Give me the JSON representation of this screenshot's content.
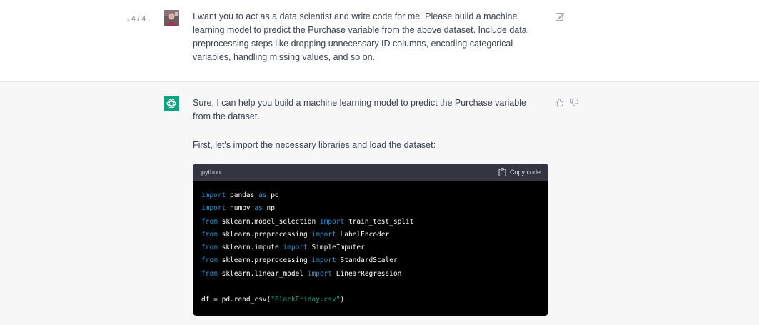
{
  "user_message": {
    "pager": {
      "current": "4",
      "separator": "/",
      "total": "4"
    },
    "text": "I want you to act as a data scientist and write code for me. Please build a machine learning model to predict the Purchase variable from the above dataset. Include data preprocessing steps like dropping unnecessary ID columns, encoding categorical variables, handling missing values, and so on."
  },
  "assistant_message": {
    "paragraphs": [
      "Sure, I can help you build a machine learning model to predict the Purchase variable from the dataset.",
      "First, let's import the necessary libraries and load the dataset:"
    ],
    "code_block": {
      "language": "python",
      "copy_label": "Copy code",
      "lines": [
        [
          {
            "t": "import",
            "c": "kw"
          },
          {
            "t": " pandas "
          },
          {
            "t": "as",
            "c": "kw"
          },
          {
            "t": " pd"
          }
        ],
        [
          {
            "t": "import",
            "c": "kw"
          },
          {
            "t": " numpy "
          },
          {
            "t": "as",
            "c": "kw"
          },
          {
            "t": " np"
          }
        ],
        [
          {
            "t": "from",
            "c": "kw"
          },
          {
            "t": " sklearn.model_selection "
          },
          {
            "t": "import",
            "c": "kw"
          },
          {
            "t": " train_test_split"
          }
        ],
        [
          {
            "t": "from",
            "c": "kw"
          },
          {
            "t": " sklearn.preprocessing "
          },
          {
            "t": "import",
            "c": "kw"
          },
          {
            "t": " LabelEncoder"
          }
        ],
        [
          {
            "t": "from",
            "c": "kw"
          },
          {
            "t": " sklearn.impute "
          },
          {
            "t": "import",
            "c": "kw"
          },
          {
            "t": " SimpleImputer"
          }
        ],
        [
          {
            "t": "from",
            "c": "kw"
          },
          {
            "t": " sklearn.preprocessing "
          },
          {
            "t": "import",
            "c": "kw"
          },
          {
            "t": " StandardScaler"
          }
        ],
        [
          {
            "t": "from",
            "c": "kw"
          },
          {
            "t": " sklearn.linear_model "
          },
          {
            "t": "import",
            "c": "kw"
          },
          {
            "t": " LinearRegression"
          }
        ],
        [],
        [
          {
            "t": "df = pd.read_csv("
          },
          {
            "t": "\"BlackFriday.csv\"",
            "c": "str"
          },
          {
            "t": ")"
          }
        ]
      ]
    }
  },
  "colors": {
    "brand": "#10a37f",
    "code_bg": "#000000",
    "code_header_bg": "#343541",
    "keyword": "#2e95d3",
    "string": "#00a67d",
    "assistant_row_bg": "#f7f7f8"
  },
  "icons": {
    "edit": "edit-icon",
    "thumbs_up": "thumbs-up-icon",
    "thumbs_down": "thumbs-down-icon",
    "copy": "clipboard-icon",
    "assistant": "openai-logo-icon"
  }
}
